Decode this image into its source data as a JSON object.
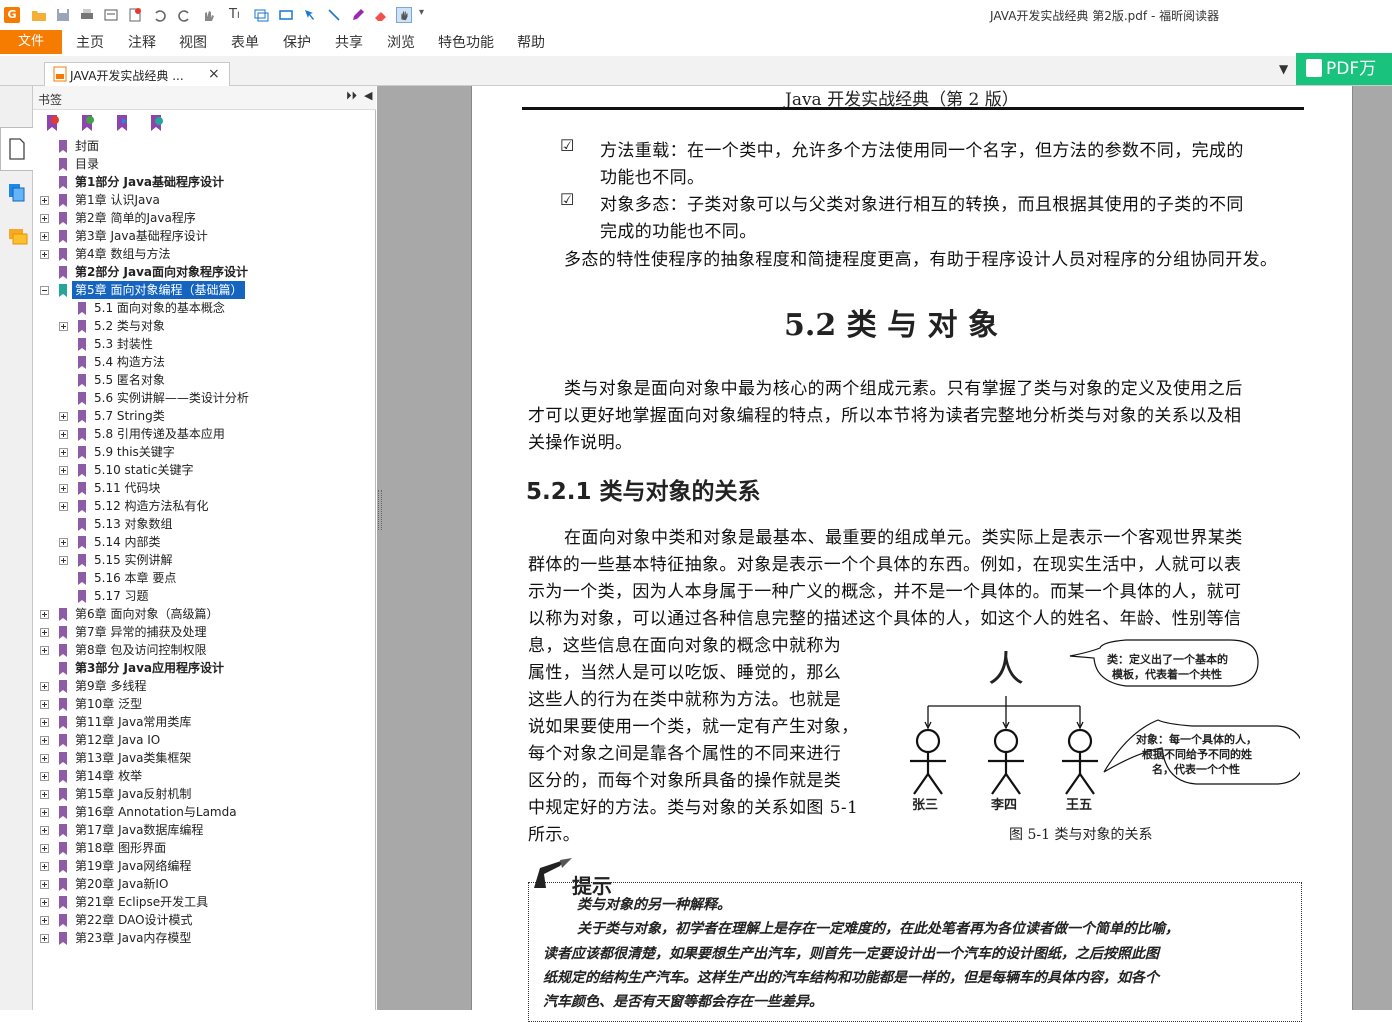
{
  "window": {
    "title": "JAVA开发实战经典 第2版.pdf - 福昕阅读器"
  },
  "menu": {
    "file": "文件",
    "items": [
      "主页",
      "注释",
      "视图",
      "表单",
      "保护",
      "共享",
      "浏览",
      "特色功能",
      "帮助"
    ]
  },
  "tab": {
    "label": "JAVA开发实战经典 ...",
    "close": "×"
  },
  "banner": {
    "label": "PDF万"
  },
  "sidebar": {
    "title": "书签"
  },
  "bookmarks": [
    {
      "label": "封面",
      "bold": false,
      "level": 0,
      "exp": ""
    },
    {
      "label": "目录",
      "bold": false,
      "level": 0,
      "exp": ""
    },
    {
      "label": "第1部分 Java基础程序设计",
      "bold": true,
      "level": 0,
      "exp": ""
    },
    {
      "label": "第1章 认识Java",
      "bold": false,
      "level": 0,
      "exp": "plus"
    },
    {
      "label": "第2章 简单的Java程序",
      "bold": false,
      "level": 0,
      "exp": "plus"
    },
    {
      "label": "第3章 Java基础程序设计",
      "bold": false,
      "level": 0,
      "exp": "plus"
    },
    {
      "label": "第4章 数组与方法",
      "bold": false,
      "level": 0,
      "exp": "plus"
    },
    {
      "label": "第2部分 Java面向对象程序设计",
      "bold": true,
      "level": 0,
      "exp": ""
    },
    {
      "label": "第5章 面向对象编程（基础篇）",
      "bold": false,
      "level": 0,
      "exp": "minus",
      "selected": true
    },
    {
      "label": "5.1 面向对象的基本概念",
      "bold": false,
      "level": 1,
      "exp": ""
    },
    {
      "label": "5.2 类与对象",
      "bold": false,
      "level": 1,
      "exp": "plus"
    },
    {
      "label": "5.3 封装性",
      "bold": false,
      "level": 1,
      "exp": ""
    },
    {
      "label": "5.4 构造方法",
      "bold": false,
      "level": 1,
      "exp": ""
    },
    {
      "label": "5.5 匿名对象",
      "bold": false,
      "level": 1,
      "exp": ""
    },
    {
      "label": "5.6 实例讲解——类设计分析",
      "bold": false,
      "level": 1,
      "exp": ""
    },
    {
      "label": "5.7 String类",
      "bold": false,
      "level": 1,
      "exp": "plus"
    },
    {
      "label": "5.8 引用传递及基本应用",
      "bold": false,
      "level": 1,
      "exp": "plus"
    },
    {
      "label": "5.9 this关键字",
      "bold": false,
      "level": 1,
      "exp": "plus"
    },
    {
      "label": "5.10 static关键字",
      "bold": false,
      "level": 1,
      "exp": "plus"
    },
    {
      "label": "5.11 代码块",
      "bold": false,
      "level": 1,
      "exp": "plus"
    },
    {
      "label": "5.12 构造方法私有化",
      "bold": false,
      "level": 1,
      "exp": "plus"
    },
    {
      "label": "5.13 对象数组",
      "bold": false,
      "level": 1,
      "exp": ""
    },
    {
      "label": "5.14 内部类",
      "bold": false,
      "level": 1,
      "exp": "plus"
    },
    {
      "label": "5.15 实例讲解",
      "bold": false,
      "level": 1,
      "exp": "plus"
    },
    {
      "label": "5.16 本章 要点",
      "bold": false,
      "level": 1,
      "exp": ""
    },
    {
      "label": "5.17 习题",
      "bold": false,
      "level": 1,
      "exp": ""
    },
    {
      "label": "第6章 面向对象（高级篇）",
      "bold": false,
      "level": 0,
      "exp": "plus"
    },
    {
      "label": "第7章 异常的捕获及处理",
      "bold": false,
      "level": 0,
      "exp": "plus"
    },
    {
      "label": "第8章 包及访问控制权限",
      "bold": false,
      "level": 0,
      "exp": "plus"
    },
    {
      "label": "第3部分 Java应用程序设计",
      "bold": true,
      "level": 0,
      "exp": ""
    },
    {
      "label": "第9章 多线程",
      "bold": false,
      "level": 0,
      "exp": "plus"
    },
    {
      "label": "第10章 泛型",
      "bold": false,
      "level": 0,
      "exp": "plus"
    },
    {
      "label": "第11章 Java常用类库",
      "bold": false,
      "level": 0,
      "exp": "plus"
    },
    {
      "label": "第12章 Java IO",
      "bold": false,
      "level": 0,
      "exp": "plus"
    },
    {
      "label": "第13章 Java类集框架",
      "bold": false,
      "level": 0,
      "exp": "plus"
    },
    {
      "label": "第14章 枚举",
      "bold": false,
      "level": 0,
      "exp": "plus"
    },
    {
      "label": "第15章 Java反射机制",
      "bold": false,
      "level": 0,
      "exp": "plus"
    },
    {
      "label": "第16章 Annotation与Lamda",
      "bold": false,
      "level": 0,
      "exp": "plus"
    },
    {
      "label": "第17章 Java数据库编程",
      "bold": false,
      "level": 0,
      "exp": "plus"
    },
    {
      "label": "第18章 图形界面",
      "bold": false,
      "level": 0,
      "exp": "plus"
    },
    {
      "label": "第19章 Java网络编程",
      "bold": false,
      "level": 0,
      "exp": "plus"
    },
    {
      "label": "第20章 Java新IO",
      "bold": false,
      "level": 0,
      "exp": "plus"
    },
    {
      "label": "第21章 Eclipse开发工具",
      "bold": false,
      "level": 0,
      "exp": "plus"
    },
    {
      "label": "第22章 DAO设计模式",
      "bold": false,
      "level": 0,
      "exp": "plus"
    },
    {
      "label": "第23章 Java内存模型",
      "bold": false,
      "level": 0,
      "exp": "plus"
    }
  ],
  "page": {
    "header": "Java 开发实战经典（第 2 版）",
    "bullets": [
      [
        "方法重载：在一个类中，允许多个方法使用同一个名字，但方法的参数不同，完成的",
        "功能也不同。"
      ],
      [
        "对象多态：子类对象可以与父类对象进行相互的转换，而且根据其使用的子类的不同",
        "完成的功能也不同。"
      ]
    ],
    "poly": "多态的特性使程序的抽象程度和简捷程度更高，有助于程序设计人员对程序的分组协同开发。",
    "section_title": "5.2   类 与 对 象",
    "intro": [
      "类与对象是面向对象中最为核心的两个组成元素。只有掌握了类与对象的定义及使用之后",
      "才可以更好地掌握面向对象编程的特点，所以本节将为读者完整地分析类与对象的关系以及相",
      "关操作说明。"
    ],
    "sub_title": "5.2.1   类与对象的关系",
    "body_full": [
      "在面向对象中类和对象是最基本、最重要的组成单元。类实际上是表示一个客观世界某类",
      "群体的一些基本特征抽象。对象是表示一个个具体的东西。例如，在现实生活中，人就可以表",
      "示为一个类，因为人本身属于一种广义的概念，并不是一个具体的。而某一个具体的人，就可",
      "以称为对象，可以通过各种信息完整的描述这个具体的人，如这个人的姓名、年龄、性别等信"
    ],
    "body_left": [
      "息，这些信息在面向对象的概念中就称为",
      "属性，当然人是可以吃饭、睡觉的，那么",
      "这些人的行为在类中就称为方法。也就是",
      "说如果要使用一个类，就一定有产生对象，",
      "每个对象之间是靠各个属性的不同来进行",
      "区分的，而每个对象所具备的操作就是类",
      "中规定好的方法。类与对象的关系如图 5-1",
      "所示。"
    ],
    "figure": {
      "root": "人",
      "class_note": [
        "类：定义出了一个基本的",
        "模板，代表着一个共性"
      ],
      "object_note": [
        "对象：每一个具体的人，",
        "根据不同给予不同的姓",
        "名，代表一个个性"
      ],
      "people": [
        "张三",
        "李四",
        "王五"
      ],
      "caption": "图 5-1    类与对象的关系"
    },
    "tip": {
      "label": "提示",
      "title": "类与对象的另一种解释。",
      "lines": [
        "关于类与对象，初学者在理解上是存在一定难度的，在此处笔者再为各位读者做一个简单的比喻，",
        "读者应该都很清楚，如果要想生产出汽车，则首先一定要设计出一个汽车的设计图纸，之后按照此图",
        "纸规定的结构生产汽车。这样生产出的汽车结构和功能都是一样的，但是每辆车的具体内容，如各个",
        "汽车颜色、是否有天窗等都会存在一些差异。"
      ]
    }
  }
}
